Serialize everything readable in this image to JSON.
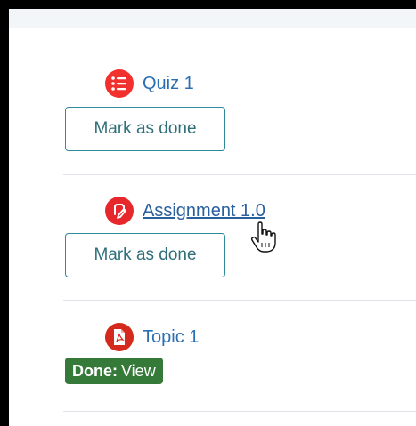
{
  "activities": [
    {
      "name": "Quiz 1",
      "icon": "quiz-list-icon",
      "icon_color": "#f0312e",
      "action_label": "Mark as done"
    },
    {
      "name": "Assignment 1.0",
      "icon": "assignment-pen-icon",
      "icon_color": "#e6282c",
      "action_label": "Mark as done"
    },
    {
      "name": "Topic 1",
      "icon": "pdf-file-icon",
      "icon_color": "#d42a1e",
      "status_label": "Done:",
      "status_action": "View",
      "status_color": "#357a38"
    }
  ],
  "cursor": "hand-pointer-icon"
}
